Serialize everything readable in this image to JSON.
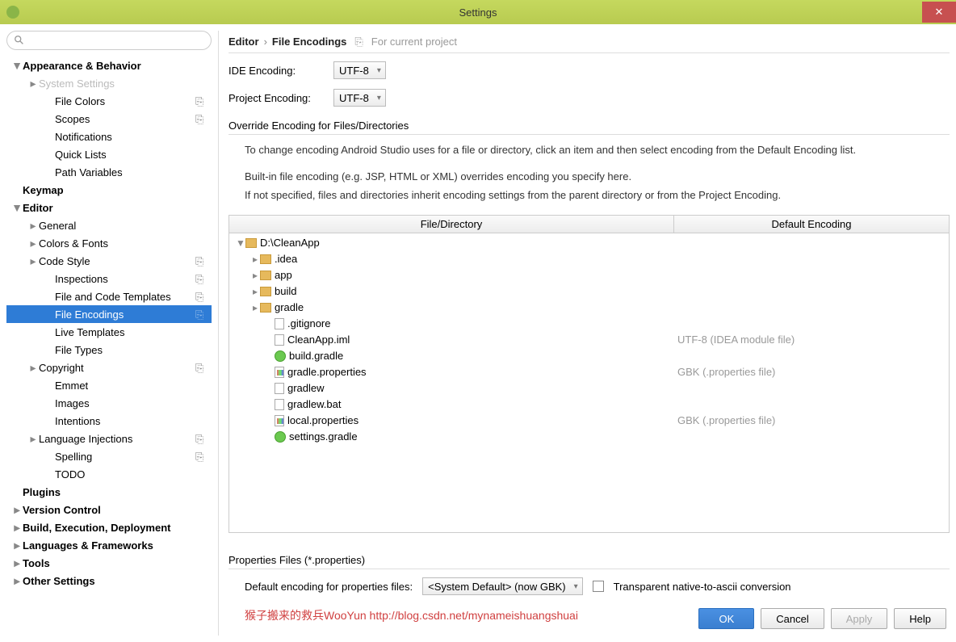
{
  "window": {
    "title": "Settings"
  },
  "breadcrumb": {
    "a": "Editor",
    "sep": "›",
    "b": "File Encodings",
    "context": "For current project"
  },
  "sidebar": {
    "items": [
      {
        "label": "Appearance & Behavior",
        "bold": true,
        "indent": 0,
        "arrow": "▼"
      },
      {
        "label": "System Settings",
        "indent": 1,
        "arrow": "▸",
        "dim": true
      },
      {
        "label": "File Colors",
        "indent": 2,
        "copy": true
      },
      {
        "label": "Scopes",
        "indent": 2,
        "copy": true
      },
      {
        "label": "Notifications",
        "indent": 2
      },
      {
        "label": "Quick Lists",
        "indent": 2
      },
      {
        "label": "Path Variables",
        "indent": 2
      },
      {
        "label": "Keymap",
        "bold": true,
        "indent": 0
      },
      {
        "label": "Editor",
        "bold": true,
        "indent": 0,
        "arrow": "▼"
      },
      {
        "label": "General",
        "indent": 1,
        "arrow": "▸"
      },
      {
        "label": "Colors & Fonts",
        "indent": 1,
        "arrow": "▸"
      },
      {
        "label": "Code Style",
        "indent": 1,
        "arrow": "▸",
        "copy": true
      },
      {
        "label": "Inspections",
        "indent": 2,
        "copy": true
      },
      {
        "label": "File and Code Templates",
        "indent": 2,
        "copy": true
      },
      {
        "label": "File Encodings",
        "indent": 2,
        "copy": true,
        "selected": true
      },
      {
        "label": "Live Templates",
        "indent": 2
      },
      {
        "label": "File Types",
        "indent": 2
      },
      {
        "label": "Copyright",
        "indent": 1,
        "arrow": "▸",
        "copy": true
      },
      {
        "label": "Emmet",
        "indent": 2
      },
      {
        "label": "Images",
        "indent": 2
      },
      {
        "label": "Intentions",
        "indent": 2
      },
      {
        "label": "Language Injections",
        "indent": 1,
        "arrow": "▸",
        "copy": true
      },
      {
        "label": "Spelling",
        "indent": 2,
        "copy": true
      },
      {
        "label": "TODO",
        "indent": 2
      },
      {
        "label": "Plugins",
        "bold": true,
        "indent": 0
      },
      {
        "label": "Version Control",
        "bold": true,
        "indent": 0,
        "arrow": "▸"
      },
      {
        "label": "Build, Execution, Deployment",
        "bold": true,
        "indent": 0,
        "arrow": "▸"
      },
      {
        "label": "Languages & Frameworks",
        "bold": true,
        "indent": 0,
        "arrow": "▸"
      },
      {
        "label": "Tools",
        "bold": true,
        "indent": 0,
        "arrow": "▸"
      },
      {
        "label": "Other Settings",
        "bold": true,
        "indent": 0,
        "arrow": "▸"
      }
    ]
  },
  "form": {
    "ide_label": "IDE Encoding:",
    "ide_value": "UTF-8",
    "project_label": "Project Encoding:",
    "project_value": "UTF-8",
    "override_title": "Override Encoding for Files/Directories",
    "help1": "To change encoding Android Studio uses for a file or directory, click an item and then select encoding from the Default Encoding list.",
    "help2": "Built-in file encoding (e.g. JSP, HTML or XML) overrides encoding you specify here.",
    "help3": "If not specified, files and directories inherit encoding settings from the parent directory or from the Project Encoding."
  },
  "table": {
    "col_file": "File/Directory",
    "col_enc": "Default Encoding",
    "rows": [
      {
        "indent": 0,
        "arrow": "▼",
        "icon": "folder",
        "name": "D:\\CleanApp",
        "enc": ""
      },
      {
        "indent": 1,
        "arrow": "▸",
        "icon": "folder",
        "name": ".idea",
        "enc": ""
      },
      {
        "indent": 1,
        "arrow": "▸",
        "icon": "folder",
        "name": "app",
        "enc": ""
      },
      {
        "indent": 1,
        "arrow": "▸",
        "icon": "folder",
        "name": "build",
        "enc": ""
      },
      {
        "indent": 1,
        "arrow": "▸",
        "icon": "folder",
        "name": "gradle",
        "enc": ""
      },
      {
        "indent": 2,
        "icon": "file",
        "name": ".gitignore",
        "enc": ""
      },
      {
        "indent": 2,
        "icon": "file",
        "name": "CleanApp.iml",
        "enc": "UTF-8 (IDEA module file)"
      },
      {
        "indent": 2,
        "icon": "g",
        "name": "build.gradle",
        "enc": ""
      },
      {
        "indent": 2,
        "icon": "bars",
        "name": "gradle.properties",
        "enc": "GBK (.properties file)"
      },
      {
        "indent": 2,
        "icon": "file",
        "name": "gradlew",
        "enc": ""
      },
      {
        "indent": 2,
        "icon": "file",
        "name": "gradlew.bat",
        "enc": ""
      },
      {
        "indent": 2,
        "icon": "bars",
        "name": "local.properties",
        "enc": "GBK (.properties file)"
      },
      {
        "indent": 2,
        "icon": "g",
        "name": "settings.gradle",
        "enc": ""
      }
    ]
  },
  "props": {
    "title": "Properties Files (*.properties)",
    "label": "Default encoding for properties files:",
    "value": "<System Default> (now GBK)",
    "checkbox_label": "Transparent native-to-ascii conversion"
  },
  "buttons": {
    "ok": "OK",
    "cancel": "Cancel",
    "apply": "Apply",
    "help": "Help"
  },
  "watermark": "猴子搬来的救兵WooYun http://blog.csdn.net/mynameishuangshuai"
}
